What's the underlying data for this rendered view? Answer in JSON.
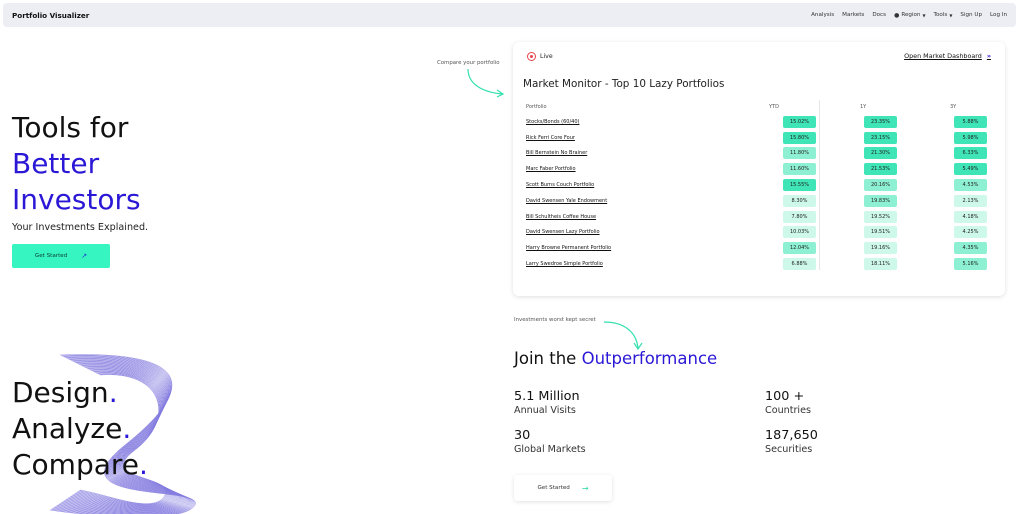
{
  "navbar": {
    "brand": "Portfolio Visualizer",
    "links": [
      "Analysis",
      "Markets",
      "Docs",
      "Region",
      "Tools",
      "Sign Up",
      "Log In"
    ]
  },
  "hero": {
    "line1": "Tools for",
    "line2": "Better",
    "line3": "Investors",
    "subtitle": "Your Investments Explained.",
    "cta": "Get Started"
  },
  "taglines": {
    "design": "Design",
    "analyze": "Analyze",
    "compare": "Compare",
    "dot": "."
  },
  "compare_note": "Compare your portfolio",
  "monitor": {
    "live": "Live",
    "dashboard_link": "Open Market Dashboard",
    "dashboard_chevron": "»",
    "title": "Market Monitor - Top 10 Lazy Portfolios",
    "headers": [
      "Portfolio",
      "YTD",
      "1Y",
      "3Y"
    ],
    "rows": [
      {
        "name": "Stocks/Bonds (60/40)",
        "ytd": "15.02%",
        "y1": "23.35%",
        "y3": "5.88%"
      },
      {
        "name": "Rick Ferri Core Four",
        "ytd": "15.80%",
        "y1": "23.15%",
        "y3": "5.98%"
      },
      {
        "name": "Bill Bernstein No Brainer",
        "ytd": "11.80%",
        "y1": "21.30%",
        "y3": "6.33%"
      },
      {
        "name": "Marc Faber Portfolio",
        "ytd": "11.60%",
        "y1": "21.53%",
        "y3": "5.49%"
      },
      {
        "name": "Scott Burns Couch Portfolio",
        "ytd": "15.55%",
        "y1": "20.16%",
        "y3": "4.53%"
      },
      {
        "name": "David Swensen Yale Endowment",
        "ytd": "8.30%",
        "y1": "19.83%",
        "y3": "2.13%"
      },
      {
        "name": "Bill Schultheis Coffee House",
        "ytd": "7.80%",
        "y1": "19.52%",
        "y3": "4.18%"
      },
      {
        "name": "David Swensen Lazy Portfolio",
        "ytd": "10.03%",
        "y1": "19.51%",
        "y3": "4.25%"
      },
      {
        "name": "Harry Browne Permanent Portfolio",
        "ytd": "12.04%",
        "y1": "19.16%",
        "y3": "4.35%"
      },
      {
        "name": "Larry Swedroe Simple Portfolio",
        "ytd": "6.88%",
        "y1": "18.11%",
        "y3": "5.16%"
      }
    ]
  },
  "join": {
    "note": "Investments worst kept secret",
    "title_prefix": "Join the",
    "title_accent": "Outperformance",
    "stats": [
      {
        "value": "5.1 Million",
        "label": "Annual Visits"
      },
      {
        "value": "100 +",
        "label": "Countries"
      },
      {
        "value": "30",
        "label": "Global Markets"
      },
      {
        "value": "187,650",
        "label": "Securities"
      }
    ],
    "cta": "Get Started"
  },
  "colors": {
    "accent": "#2b18d6",
    "cta_bg": "#36f5c0",
    "heat_strong": "#3fe5b6",
    "heat_mid": "#8ef0d2",
    "heat_light": "#cdf8ea"
  }
}
